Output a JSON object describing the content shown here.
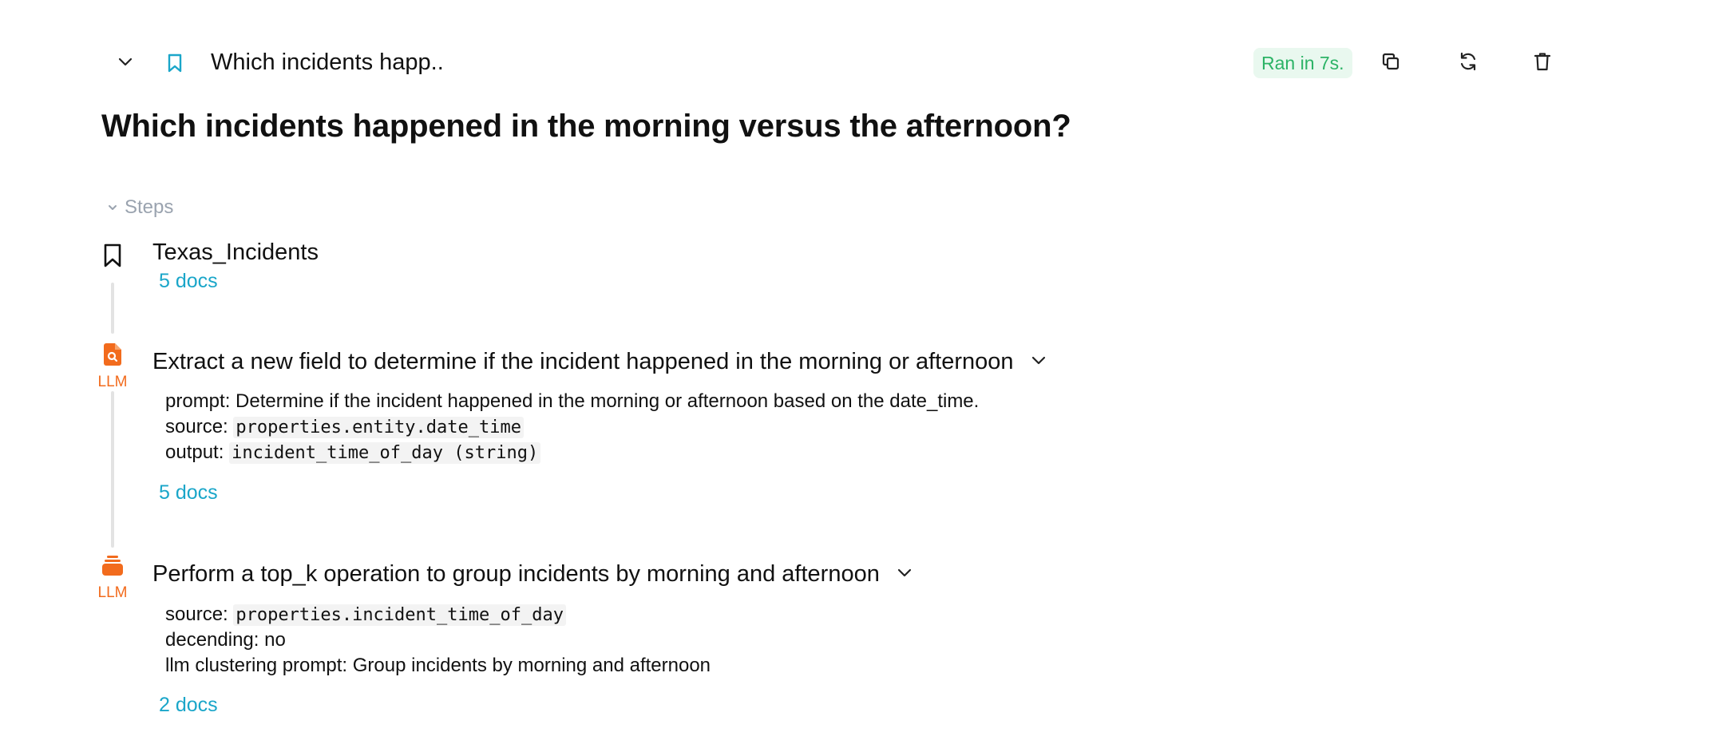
{
  "header": {
    "short_title": "Which incidents happ..",
    "run_status": "Ran in 7s.",
    "icons": {
      "collapse": "chevron-down-icon",
      "bookmark": "bookmark-icon",
      "copy": "copy-icon",
      "rerun": "refresh-icon",
      "delete": "trash-icon"
    }
  },
  "query": {
    "title": "Which incidents happened in the morning versus the afternoon?"
  },
  "steps_section": {
    "label": "Steps"
  },
  "steps": [
    {
      "title": "Texas_Incidents",
      "icon": "bookmark-icon",
      "docs": "5 docs"
    },
    {
      "title": "Extract a new field to determine if the incident happened in the morning or afternoon",
      "icon": "document-search-icon",
      "tag": "LLM",
      "details": {
        "prompt_key": "prompt:",
        "prompt_value": "Determine if the incident happened in the morning or afternoon based on the date_time.",
        "source_key": "source:",
        "source_value": "properties.entity.date_time",
        "output_key": "output:",
        "output_value": "incident_time_of_day (string)"
      },
      "docs": "5 docs"
    },
    {
      "title": "Perform a top_k operation to group incidents by morning and afternoon",
      "icon": "stack-icon",
      "tag": "LLM",
      "details": {
        "source_key": "source:",
        "source_value": "properties.incident_time_of_day",
        "descending_key": "decending:",
        "descending_value": "no",
        "clustering_key": "llm clustering prompt:",
        "clustering_value": "Group incidents by morning and afternoon"
      },
      "docs": "2 docs"
    }
  ],
  "colors": {
    "accent_link": "#1aa6c9",
    "llm_orange": "#f26b1d",
    "success_green": "#2cb366",
    "muted_gray": "#9aa3af"
  }
}
